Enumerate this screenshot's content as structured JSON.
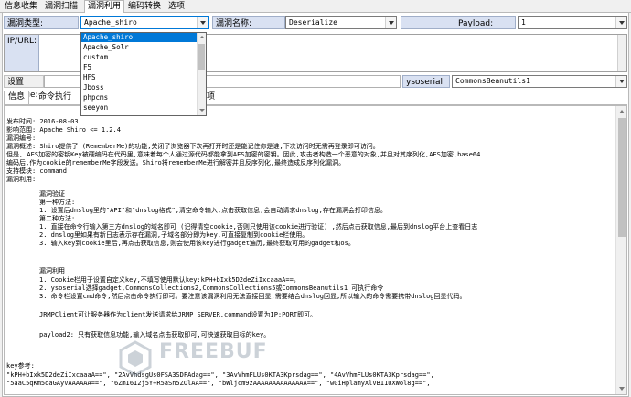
{
  "tabs": [
    {
      "label": "信息收集"
    },
    {
      "label": "漏洞扫描"
    },
    {
      "label": "漏洞利用"
    },
    {
      "label": "编码转换"
    },
    {
      "label": "选项"
    }
  ],
  "form": {
    "vuln_type_label": "漏洞类型:",
    "vuln_type_value": "Apache_shiro",
    "vuln_name_label": "漏洞名称:",
    "vuln_name_value": "Deserialize",
    "payload_label": "Payload:",
    "payload_value": "1",
    "ip_url_label": "IP/URL:",
    "cookie_label": "设置Cookie:",
    "ysoserial_label": "ysoserial:",
    "ysoserial_value": "CommonsBeanutils1"
  },
  "dropdown": {
    "items": [
      "Apache_shiro",
      "Apache_Solr",
      "custom",
      "F5",
      "HFS",
      "Jboss",
      "phpcms",
      "seeyon"
    ],
    "selected_index": 0
  },
  "info_tabs": [
    {
      "label": "信息"
    },
    {
      "label": "命令执行"
    },
    {
      "label": "项"
    }
  ],
  "content": {
    "lines": [
      "发布时间: 2016-08-03",
      "影响范围: Apache Shiro <= 1.2.4",
      "漏洞编号:",
      "漏洞概述: Shiro提供了 (RememberMe)的功能,关闭了浏览器下次再打开时还是能记住你是谁,下次访问时无需再登录即可访问。",
      "但是, AES加密的密钥Key被硬编码在代码里,意味着每个人通过源代码都能拿到AES加密的密钥。因此,攻击者构造一个恶意的对象,并且对其序列化,AES加密,base64",
      "编码后,作为cookie的rememberMe字段发送。Shiro将rememberMe进行解密并且反序列化,最终造成反序列化漏洞。",
      "支持模块: command",
      "漏洞利用:"
    ],
    "section1_title": "漏洞验证",
    "section1_lines": [
      "第一种方法:",
      "1. 设置后dnslog里的\"API\"和\"dnslog格式\",清空命令输入,点击获取信息,会自动请求dnslog,存在漏洞会打印信息。",
      "第二种方法:",
      "1. 直接在命令行输入第三方dnslog的域名即可 (记得清空cookie,否则只使用该cookie进行验证) ,然后点击获取信息,最后到dnslog平台上查看日志",
      "2. dnslog里如果有新日志表示存在漏洞,子域名部分即为key,可直接复制到cookie栏使用。",
      "3. 输入key到cookie里后,再点击获取信息,则会使用该key进行gadget遍历,最终获取可用的gadget和os。"
    ],
    "section2_title": "漏洞利用",
    "section2_lines": [
      "1. Cookie栏用于设置自定义key,不填写使用默认key:kPH+bIxk5D2deZiIxcaaaA==。",
      "2. ysoserial选择gadget,CommonsCollections2,CommonsCollections5或CommonsBeanutils1 可执行命令",
      "3. 命令栏设置cmd命令,然后点击命令执行即可。要注意该漏洞利用无法直接回显,需要结合dnslog回显,所以输入的命令需要携带dnslog回显代码。"
    ],
    "jrmp_line": "JRMPClient可让服务器作为client发送请求给JRMP SERVER,command设置为IP:PORT即可。",
    "payload2_line": "payload2: 只有获取信息功能,输入域名点击获取即可,可快速获取目标的key。",
    "keys_title": "key参考:",
    "keys_lines": [
      "\"kPH+bIxk5D2deZiIxcaaaA==\", \"2AvVhdsgUs0FSA3SDFAdag==\", \"3AvVhmFLUs0KTA3Kprsdag==\", \"4AvVhmFLUs0KTA3Kprsdag==\",",
      "\"5aaC5qKm5oaGAyVAAAAAA==\", \"6ZmI6I2j5Y+R5aSn5ZOlAA==\", \"bWljcm9zAAAAAAAAAAAAAA==\", \"wGiHplamyXlVB11UXWol8g==\","
    ]
  },
  "watermark": "FREEBUF",
  "colors": {
    "selection": "#0078d7",
    "label_bg": "#d9e1f2"
  }
}
